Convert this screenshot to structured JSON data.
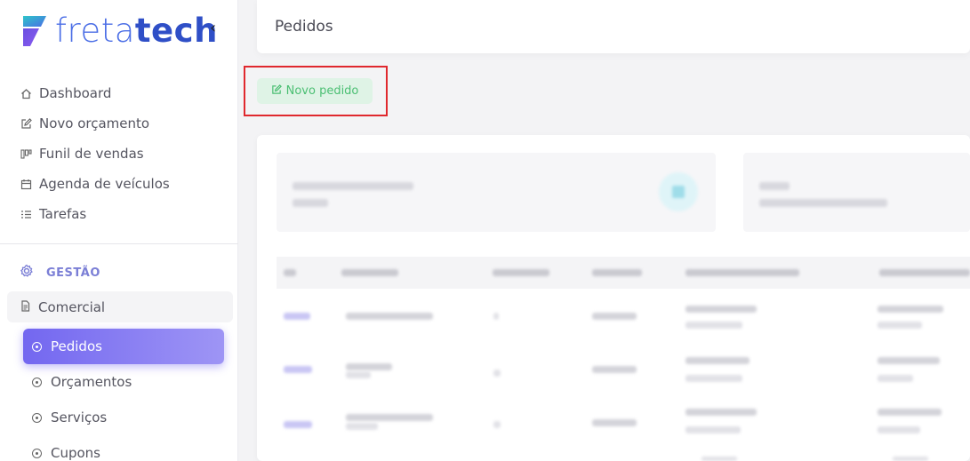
{
  "brand": {
    "logo_light": "freta",
    "logo_bold": "tech",
    "colors": {
      "primary": "#3b5bd8",
      "accent": "#7367f0",
      "success": "#4bbf73"
    }
  },
  "sidebar": {
    "collapse_icon": "chevron-left-icon",
    "collapse_glyph": "‹",
    "items": [
      {
        "label": "Dashboard",
        "icon": "home-icon"
      },
      {
        "label": "Novo orçamento",
        "icon": "edit-icon"
      },
      {
        "label": "Funil de vendas",
        "icon": "funnel-icon"
      },
      {
        "label": "Agenda de veículos",
        "icon": "calendar-icon"
      },
      {
        "label": "Tarefas",
        "icon": "list-icon"
      }
    ],
    "section": {
      "label": "GESTÃO",
      "icon": "gear-icon"
    },
    "group": {
      "label": "Comercial",
      "icon": "file-icon"
    },
    "subitems": [
      {
        "label": "Pedidos",
        "active": true
      },
      {
        "label": "Orçamentos",
        "active": false
      },
      {
        "label": "Serviços",
        "active": false
      },
      {
        "label": "Cupons",
        "active": false
      }
    ]
  },
  "header": {
    "title": "Pedidos"
  },
  "toolbar": {
    "new_order_label": "Novo pedido",
    "new_order_icon": "edit-icon"
  }
}
